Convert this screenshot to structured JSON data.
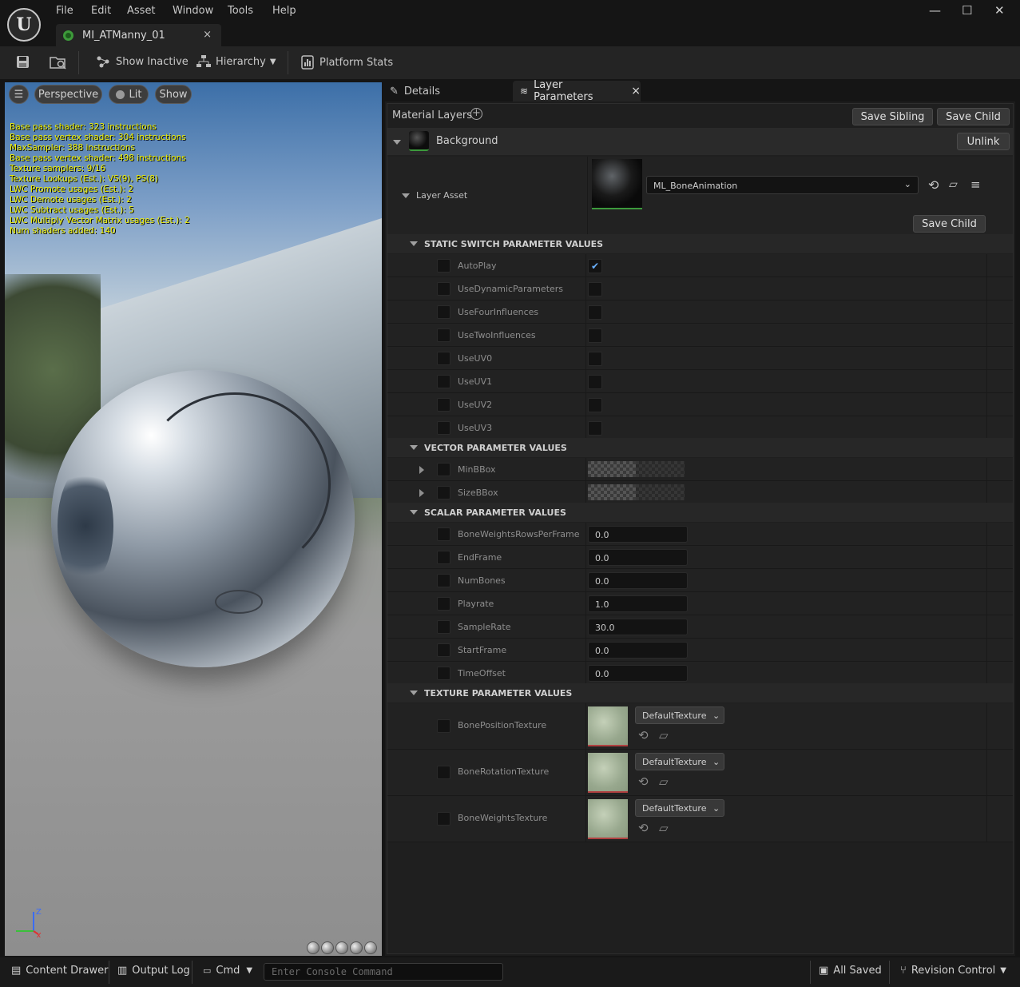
{
  "app": {
    "logo": "U"
  },
  "menu": [
    "File",
    "Edit",
    "Asset",
    "Window",
    "Tools",
    "Help"
  ],
  "document_tab": {
    "name": "MI_ATManny_01",
    "close": "×"
  },
  "window_controls": {
    "minimize": "—",
    "maximize": "☐",
    "close": "✕"
  },
  "toolbar": {
    "save_icon": "save-icon",
    "browse_icon": "browse-icon",
    "show_inactive": "Show Inactive",
    "hierarchy": "Hierarchy",
    "platform_stats": "Platform Stats"
  },
  "viewport": {
    "perspective": "Perspective",
    "lit": "Lit",
    "show": "Show",
    "stats": "Base pass shader: 323 instructions\nBase pass vertex shader: 304 instructions\nMaxSampler: 388 instructions\nBase pass vertex shader: 498 instructions\nTexture samplers: 9/16\nTexture Lookups (Est.): VS(9), PS(8)\nLWC Promote usages (Est.): 2\nLWC Demote usages (Est.): 2\nLWC Subtract usages (Est.): 5\nLWC Multiply Vector Matrix usages (Est.): 2\nNum shaders added: 140",
    "axis": {
      "z": "Z",
      "x": "X"
    }
  },
  "panel_tabs": {
    "details": "Details",
    "layer_parameters": "Layer Parameters",
    "close": "×"
  },
  "material_layers": {
    "title": "Material Layers",
    "save_sibling": "Save Sibling",
    "save_child": "Save Child",
    "background": "Background",
    "unlink": "Unlink",
    "layer_asset_label": "Layer Asset",
    "layer_asset_value": "ML_BoneAnimation",
    "layer_save_child": "Save Child"
  },
  "sections": {
    "static": "STATIC SWITCH PARAMETER VALUES",
    "vector": "VECTOR PARAMETER VALUES",
    "scalar": "SCALAR PARAMETER VALUES",
    "texture": "TEXTURE PARAMETER VALUES"
  },
  "static_switches": [
    {
      "name": "AutoPlay",
      "checked": "✔"
    },
    {
      "name": "UseDynamicParameters",
      "checked": ""
    },
    {
      "name": "UseFourInfluences",
      "checked": ""
    },
    {
      "name": "UseTwoInfluences",
      "checked": ""
    },
    {
      "name": "UseUV0",
      "checked": ""
    },
    {
      "name": "UseUV1",
      "checked": ""
    },
    {
      "name": "UseUV2",
      "checked": ""
    },
    {
      "name": "UseUV3",
      "checked": ""
    }
  ],
  "vectors": [
    {
      "name": "MinBBox"
    },
    {
      "name": "SizeBBox"
    }
  ],
  "scalars": [
    {
      "name": "BoneWeightsRowsPerFrame",
      "value": "0.0"
    },
    {
      "name": "EndFrame",
      "value": "0.0"
    },
    {
      "name": "NumBones",
      "value": "0.0"
    },
    {
      "name": "Playrate",
      "value": "1.0"
    },
    {
      "name": "SampleRate",
      "value": "30.0"
    },
    {
      "name": "StartFrame",
      "value": "0.0"
    },
    {
      "name": "TimeOffset",
      "value": "0.0"
    }
  ],
  "textures": [
    {
      "name": "BonePositionTexture",
      "value": "DefaultTexture"
    },
    {
      "name": "BoneRotationTexture",
      "value": "DefaultTexture"
    },
    {
      "name": "BoneWeightsTexture",
      "value": "DefaultTexture"
    }
  ],
  "statusbar": {
    "content_drawer": "Content Drawer",
    "output_log": "Output Log",
    "cmd": "Cmd",
    "console_placeholder": "Enter Console Command",
    "all_saved": "All Saved",
    "revision_control": "Revision Control"
  }
}
